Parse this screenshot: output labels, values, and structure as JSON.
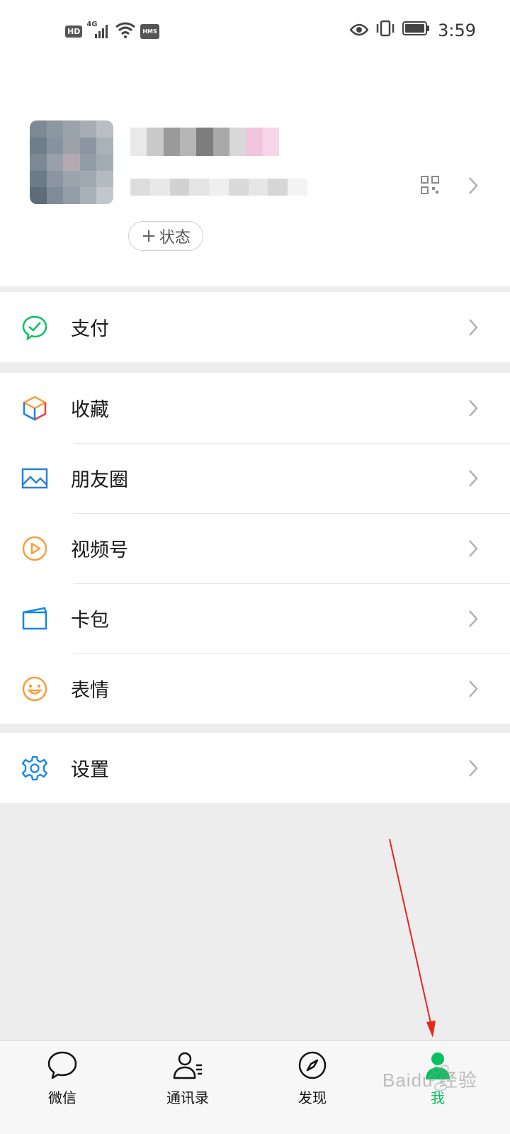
{
  "status_bar": {
    "left_badges": [
      "HD",
      "4G",
      "HMS"
    ],
    "time": "3:59"
  },
  "profile": {
    "status_button_label": "状态",
    "qr_icon": "qr-code-icon",
    "chevron_icon": "chevron-right-icon"
  },
  "menu": {
    "groups": [
      {
        "items": [
          {
            "label": "支付",
            "icon": "pay-icon",
            "color": "#07c160"
          }
        ]
      },
      {
        "items": [
          {
            "label": "收藏",
            "icon": "favorites-cube-icon",
            "color": "#fa9d3b"
          },
          {
            "label": "朋友圈",
            "icon": "moments-image-icon",
            "color": "#2782d7"
          },
          {
            "label": "视频号",
            "icon": "channels-play-icon",
            "color": "#fa9d3b"
          },
          {
            "label": "卡包",
            "icon": "card-wallet-icon",
            "color": "#1485ee"
          },
          {
            "label": "表情",
            "icon": "emoji-smile-icon",
            "color": "#fa9d3b"
          }
        ]
      },
      {
        "items": [
          {
            "label": "设置",
            "icon": "settings-gear-icon",
            "color": "#1485ee"
          }
        ]
      }
    ]
  },
  "tabbar": {
    "tabs": [
      {
        "label": "微信",
        "icon": "chat-bubble-icon",
        "active": false
      },
      {
        "label": "通讯录",
        "icon": "contacts-icon",
        "active": false
      },
      {
        "label": "发现",
        "icon": "compass-icon",
        "active": false
      },
      {
        "label": "我",
        "icon": "me-person-icon",
        "active": true
      }
    ]
  },
  "colors": {
    "accent": "#07c160",
    "background": "#ededed",
    "annotation_arrow": "#e6271e"
  },
  "watermark_text": "Baidu 经验"
}
